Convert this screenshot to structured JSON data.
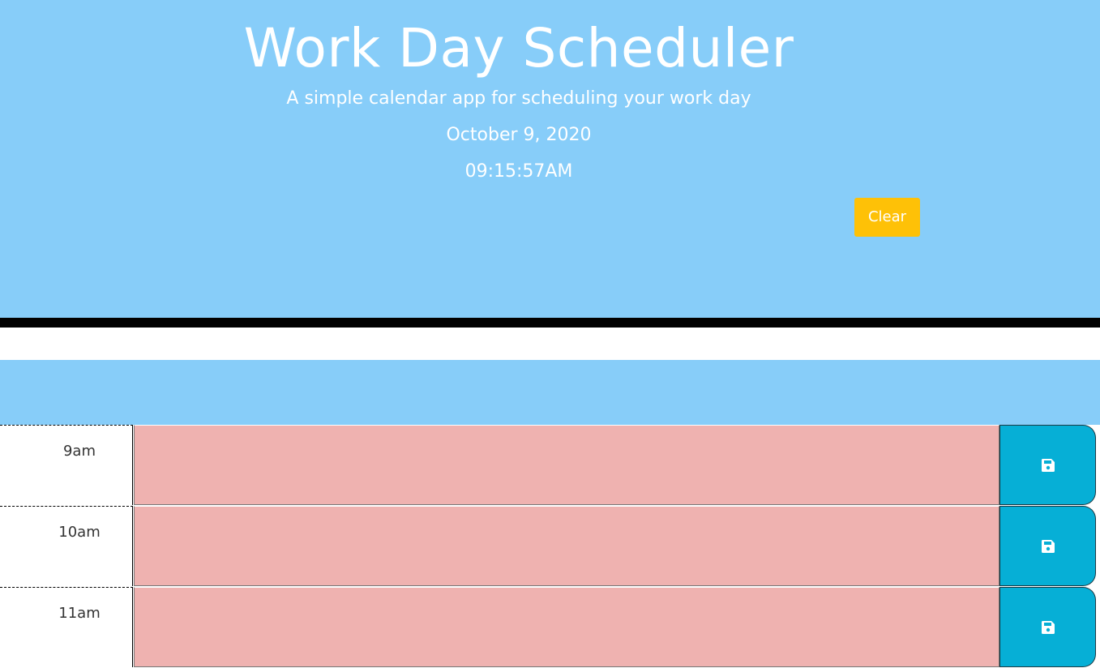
{
  "header": {
    "title": "Work Day Scheduler",
    "subtitle": "A simple calendar app for scheduling your work day",
    "date": "October 9, 2020",
    "time": "09:15:57AM",
    "clear_label": "Clear"
  },
  "colors": {
    "header_bg": "#87cdf9",
    "clear_button": "#fec107",
    "past_row": "#efb2b0",
    "save_button": "#06afd6"
  },
  "rows": [
    {
      "hour": "9am",
      "text": "",
      "save_icon": "floppy-disk-icon"
    },
    {
      "hour": "10am",
      "text": "",
      "save_icon": "floppy-disk-icon"
    },
    {
      "hour": "11am",
      "text": "",
      "save_icon": "floppy-disk-icon"
    }
  ]
}
